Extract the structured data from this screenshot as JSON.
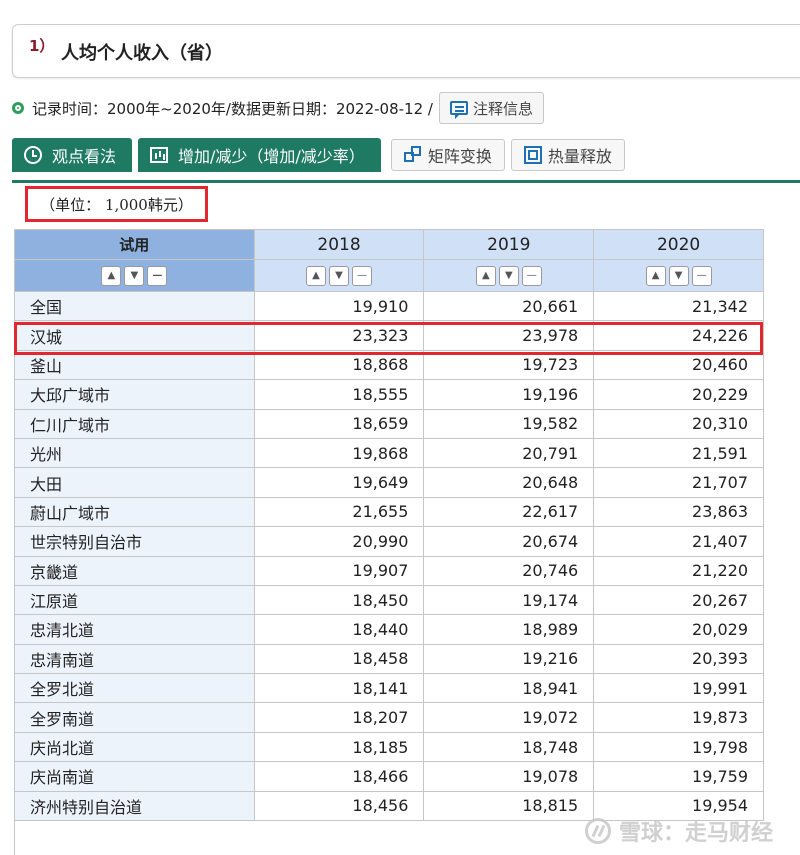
{
  "title": {
    "number": "1）",
    "text": "人均个人收入（省）"
  },
  "record": {
    "text": "记录时间：2000年~2020年/数据更新日期：2022-08-12 /",
    "note_button": "注释信息"
  },
  "toolbar": {
    "view_button": "观点看法",
    "change_button": "增加/减少（增加/减少率）",
    "matrix_button": "矩阵变换",
    "heat_button": "热量释放"
  },
  "unit": "（单位： 1,000韩元）",
  "table": {
    "row_header": "试用",
    "columns": [
      "2018",
      "2019",
      "2020"
    ],
    "rows": [
      {
        "name": "全国",
        "values": [
          "19,910",
          "20,661",
          "21,342"
        ]
      },
      {
        "name": "汉城",
        "values": [
          "23,323",
          "23,978",
          "24,226"
        ]
      },
      {
        "name": "釜山",
        "values": [
          "18,868",
          "19,723",
          "20,460"
        ]
      },
      {
        "name": "大邱广域市",
        "values": [
          "18,555",
          "19,196",
          "20,229"
        ]
      },
      {
        "name": "仁川广域市",
        "values": [
          "18,659",
          "19,582",
          "20,310"
        ]
      },
      {
        "name": "光州",
        "values": [
          "19,868",
          "20,791",
          "21,591"
        ]
      },
      {
        "name": "大田",
        "values": [
          "19,649",
          "20,648",
          "21,707"
        ]
      },
      {
        "name": "蔚山广域市",
        "values": [
          "21,655",
          "22,617",
          "23,863"
        ]
      },
      {
        "name": "世宗特别自治市",
        "values": [
          "20,990",
          "20,674",
          "21,407"
        ]
      },
      {
        "name": "京畿道",
        "values": [
          "19,907",
          "20,746",
          "21,220"
        ]
      },
      {
        "name": "江原道",
        "values": [
          "18,450",
          "19,174",
          "20,267"
        ]
      },
      {
        "name": "忠清北道",
        "values": [
          "18,440",
          "18,989",
          "20,029"
        ]
      },
      {
        "name": "忠清南道",
        "values": [
          "18,458",
          "19,216",
          "20,393"
        ]
      },
      {
        "name": "全罗北道",
        "values": [
          "18,141",
          "18,941",
          "19,991"
        ]
      },
      {
        "name": "全罗南道",
        "values": [
          "18,207",
          "19,072",
          "19,873"
        ]
      },
      {
        "name": "庆尚北道",
        "values": [
          "18,185",
          "18,748",
          "19,798"
        ]
      },
      {
        "name": "庆尚南道",
        "values": [
          "18,466",
          "19,078",
          "19,759"
        ]
      },
      {
        "name": "济州特别自治道",
        "values": [
          "18,456",
          "18,815",
          "19,954"
        ]
      }
    ]
  },
  "controls": {
    "up": "▲",
    "down": "▼",
    "minus": "—"
  },
  "watermark": "雪球：走马财经"
}
